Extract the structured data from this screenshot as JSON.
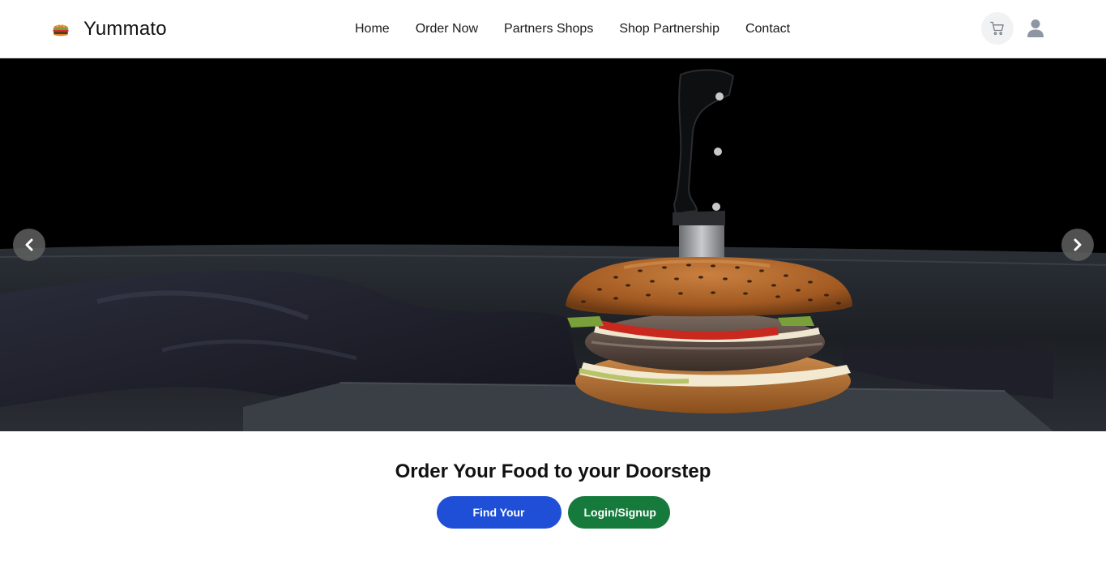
{
  "brand": {
    "name": "Yummato",
    "logo_icon": "burger-icon"
  },
  "nav": {
    "links": [
      {
        "label": "Home"
      },
      {
        "label": "Order Now"
      },
      {
        "label": "Partners Shops"
      },
      {
        "label": "Shop Partnership"
      },
      {
        "label": "Contact"
      }
    ],
    "cart_icon": "cart-icon",
    "user_icon": "user-icon"
  },
  "hero": {
    "image": "burger-with-knife-photo",
    "prev_icon": "chevron-left-icon",
    "next_icon": "chevron-right-icon"
  },
  "cta": {
    "title": "Order Your Food to your Doorstep",
    "find_label": "Find Your Product",
    "login_label": "Login/Signup"
  },
  "colors": {
    "primary_button": "#1f4fd6",
    "success_button": "#157a3c",
    "carousel_control": "#5f5f5f"
  }
}
